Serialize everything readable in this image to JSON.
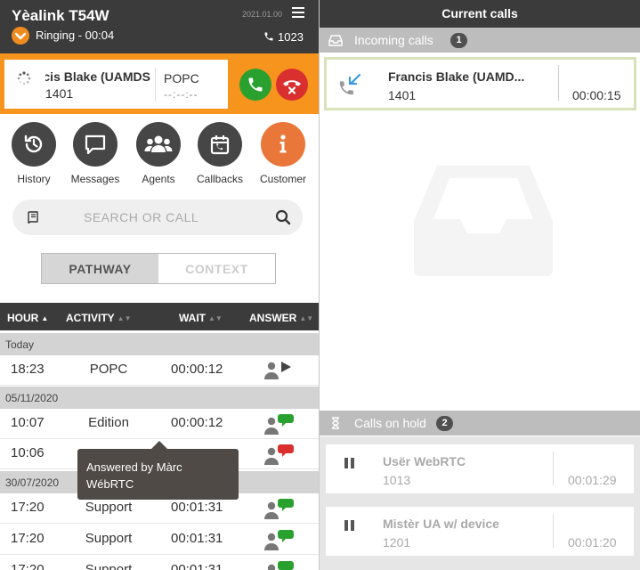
{
  "header": {
    "device_name": "Yèalink T54W",
    "date": "2021.01.00",
    "status": "Ringing",
    "status_timer": " - 00:04",
    "extension": "1023"
  },
  "active_call": {
    "name": "Francis Blake (UAMDS",
    "number": "1401",
    "activity": "POPC",
    "timer": "--:--:--"
  },
  "nav": [
    {
      "label": "History",
      "icon": "history-icon"
    },
    {
      "label": "Messages",
      "icon": "chat-bubble-icon"
    },
    {
      "label": "Agents",
      "icon": "people-icon"
    },
    {
      "label": "Callbacks",
      "icon": "calendar-icon"
    },
    {
      "label": "Customer",
      "icon": "info-icon"
    }
  ],
  "search": {
    "placeholder": "SEARCH OR CALL"
  },
  "tabs": {
    "pathway": "PATHWAY",
    "context": "CONTEXT",
    "active": "pathway"
  },
  "table": {
    "headers": {
      "hour": "HOUR",
      "activity": "ACTIVITY",
      "wait": "WAIT",
      "answer": "ANSWER"
    },
    "groups": [
      {
        "label": "Today",
        "rows": [
          {
            "hour": "18:23",
            "activity": "POPC",
            "wait": "00:00:12",
            "answer": "play"
          }
        ]
      },
      {
        "label": "05/11/2020",
        "rows": [
          {
            "hour": "10:07",
            "activity": "Edition",
            "wait": "00:00:12",
            "answer": "green-bubble"
          },
          {
            "hour": "10:06",
            "activity": "",
            "wait": "",
            "answer": "red-bubble"
          }
        ]
      },
      {
        "label": "30/07/2020",
        "rows": [
          {
            "hour": "17:20",
            "activity": "Support",
            "wait": "00:01:31",
            "answer": "green-bubble"
          },
          {
            "hour": "17:20",
            "activity": "Support",
            "wait": "00:01:31",
            "answer": "green-bubble"
          },
          {
            "hour": "17:20",
            "activity": "Support",
            "wait": "00:01:31",
            "answer": "green-bubble"
          }
        ]
      }
    ]
  },
  "tooltip": {
    "line1": "Answered by Màrc",
    "line2": "WébRTC"
  },
  "current_calls": {
    "title": "Current calls",
    "incoming": {
      "label": "Incoming calls",
      "count": "1",
      "calls": [
        {
          "name": "Francis Blake (UAMD...",
          "number": "1401",
          "time": "00:00:15"
        }
      ]
    },
    "on_hold": {
      "label": "Calls on hold",
      "count": "2",
      "calls": [
        {
          "name": "Usër WebRTC",
          "number": "1013",
          "time": "00:01:29"
        },
        {
          "name": "Mistèr UA w/ device",
          "number": "1201",
          "time": "00:01:20"
        }
      ]
    }
  },
  "colors": {
    "accent_orange": "#f7941d",
    "dark_bar": "#3b3b3b",
    "answer_green": "#2aa12f",
    "hangup_red": "#d9302f",
    "customer_orange": "#e9773a",
    "incoming_border": "#d8e3b9"
  }
}
